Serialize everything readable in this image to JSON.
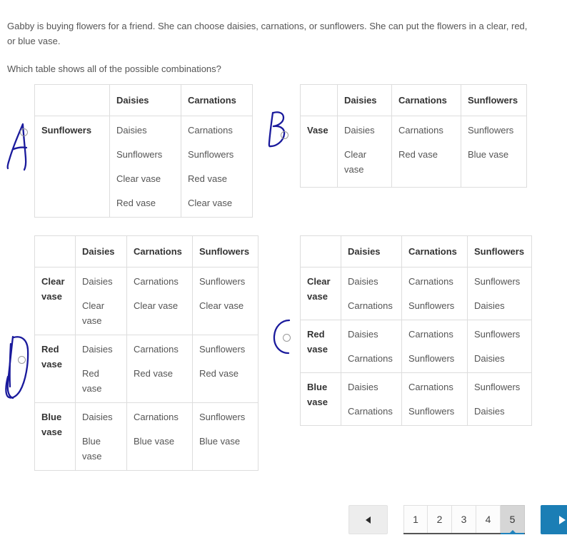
{
  "question": {
    "paragraph1": "Gabby is buying flowers for a friend. She can choose daisies, carnations, or sunflowers. She can put the flowers in a clear, red, or blue vase.",
    "paragraph2": "Which table shows all of the possible combinations?"
  },
  "options": [
    {
      "letter": "A",
      "headers": [
        "",
        "Daisies",
        "Carnations"
      ],
      "rows": [
        {
          "label": "Sunflowers",
          "cells": [
            [
              "Daisies",
              "Sunflowers",
              "Clear vase",
              "Red vase"
            ],
            [
              "Carnations",
              "Sunflowers",
              "Red vase",
              "Clear vase"
            ]
          ]
        }
      ]
    },
    {
      "letter": "B",
      "headers": [
        "",
        "Daisies",
        "Carnations",
        "Sunflowers"
      ],
      "rows": [
        {
          "label": "Vase",
          "cells": [
            [
              "Daisies",
              "Clear vase"
            ],
            [
              "Carnations",
              "Red vase"
            ],
            [
              "Sunflowers",
              "Blue vase"
            ]
          ]
        }
      ]
    },
    {
      "letter": "C",
      "headers": [
        "",
        "Daisies",
        "Carnations",
        "Sunflowers"
      ],
      "rows": [
        {
          "label": "Clear vase",
          "cells": [
            [
              "Daisies",
              "Clear vase"
            ],
            [
              "Carnations",
              "Clear vase"
            ],
            [
              "Sunflowers",
              "Clear vase"
            ]
          ]
        },
        {
          "label": "Red vase",
          "cells": [
            [
              "Daisies",
              "Red vase"
            ],
            [
              "Carnations",
              "Red vase"
            ],
            [
              "Sunflowers",
              "Red vase"
            ]
          ]
        },
        {
          "label": "Blue vase",
          "cells": [
            [
              "Daisies",
              "Blue vase"
            ],
            [
              "Carnations",
              "Blue vase"
            ],
            [
              "Sunflowers",
              "Blue vase"
            ]
          ]
        }
      ]
    },
    {
      "letter": "D",
      "headers": [
        "",
        "Daisies",
        "Carnations",
        "Sunflowers"
      ],
      "rows": [
        {
          "label": "Clear vase",
          "cells": [
            [
              "Daisies",
              "Carnations"
            ],
            [
              "Carnations",
              "Sunflowers"
            ],
            [
              "Sunflowers",
              "Daisies"
            ]
          ]
        },
        {
          "label": "Red vase",
          "cells": [
            [
              "Daisies",
              "Carnations"
            ],
            [
              "Carnations",
              "Sunflowers"
            ],
            [
              "Sunflowers",
              "Daisies"
            ]
          ]
        },
        {
          "label": "Blue vase",
          "cells": [
            [
              "Daisies",
              "Carnations"
            ],
            [
              "Carnations",
              "Sunflowers"
            ],
            [
              "Sunflowers",
              "Daisies"
            ]
          ]
        }
      ]
    }
  ],
  "annotations": {
    "ink_color": "#1a1a9c",
    "letters": [
      "A",
      "B",
      "D",
      "C"
    ]
  },
  "pagination": {
    "prev_label": "◄",
    "next_label": "►",
    "pages": [
      "1",
      "2",
      "3",
      "4",
      "5"
    ],
    "active_page": "5",
    "accent_color": "#1b7eb5"
  }
}
